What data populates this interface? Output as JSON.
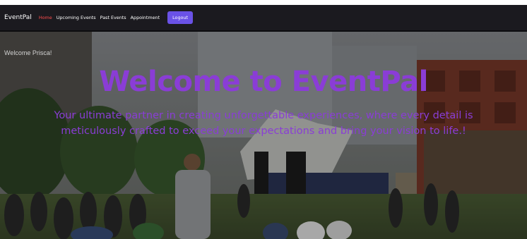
{
  "navbar": {
    "brand": "EventPal",
    "links": [
      {
        "label": "Home",
        "active": true
      },
      {
        "label": "Upcoming Events",
        "active": false
      },
      {
        "label": "Past Events",
        "active": false
      },
      {
        "label": "Appointment",
        "active": false
      }
    ],
    "logout_label": "Logout"
  },
  "hero": {
    "welcome_user": "Welcome Prisca!",
    "title": "Welcome to EventPal",
    "subtitle": "Your ultimate partner in creating unforgettable experiences, where every detail is meticulously crafted to exceed your expectations and bring your vision to life.!"
  },
  "colors": {
    "navbar_bg": "#1b1a1f",
    "active_link": "#ff4d4d",
    "logout_button": "#6a52e6",
    "hero_text": "#8a3dd6"
  }
}
